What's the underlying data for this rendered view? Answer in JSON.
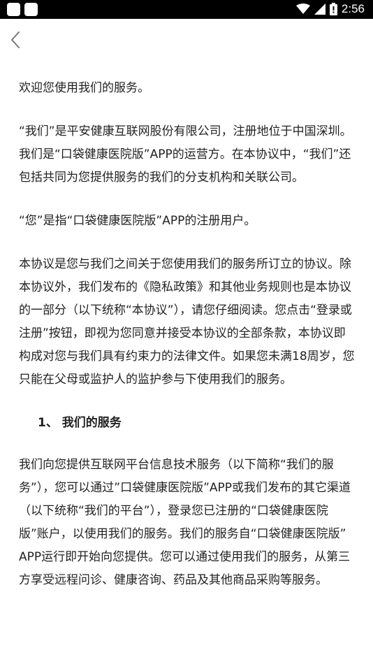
{
  "status_bar": {
    "time": "2:56",
    "icons": [
      "notification-square-icon",
      "notification-square-icon",
      "wifi-icon",
      "cell-signal-icon",
      "battery-icon"
    ]
  },
  "nav": {
    "back_icon": "chevron-left-icon"
  },
  "content": {
    "paragraphs": [
      "欢迎您使用我们的服务。",
      "“我们”是平安健康互联网股份有限公司，注册地位于中国深圳。我们是“口袋健康医院版”APP的运营方。在本协议中，“我们”还包括共同为您提供服务的我们的分支机构和关联公司。",
      "“您”是指“口袋健康医院版”APP的注册用户。",
      "本协议是您与我们之间关于您使用我们的服务所订立的协议。除本协议外，我们发布的《隐私政策》和其他业务规则也是本协议的一部分（以下统称“本协议”），请您仔细阅读。您点击“登录或注册”按钮，即视为您同意并接受本协议的全部条款，本协议即构成对您与我们具有约束力的法律文件。如果您未满18周岁，您只能在父母或监护人的监护参与下使用我们的服务。"
    ],
    "section_1_heading": "1、 我们的服务",
    "section_1_paragraph": "我们向您提供互联网平台信息技术服务（以下简称“我们的服务”），您可以通过”口袋健康医院版”APP或我们发布的其它渠道（以下统称“我们的平台”），登录您已注册的“口袋健康医院版”账户，以使用我们的服务。我们的服务自“口袋健康医院版” APP运行即开始向您提供。您可以通过使用我们的服务，从第三方享受远程问诊、健康咨询、药品及其他商品采购等服务。"
  }
}
